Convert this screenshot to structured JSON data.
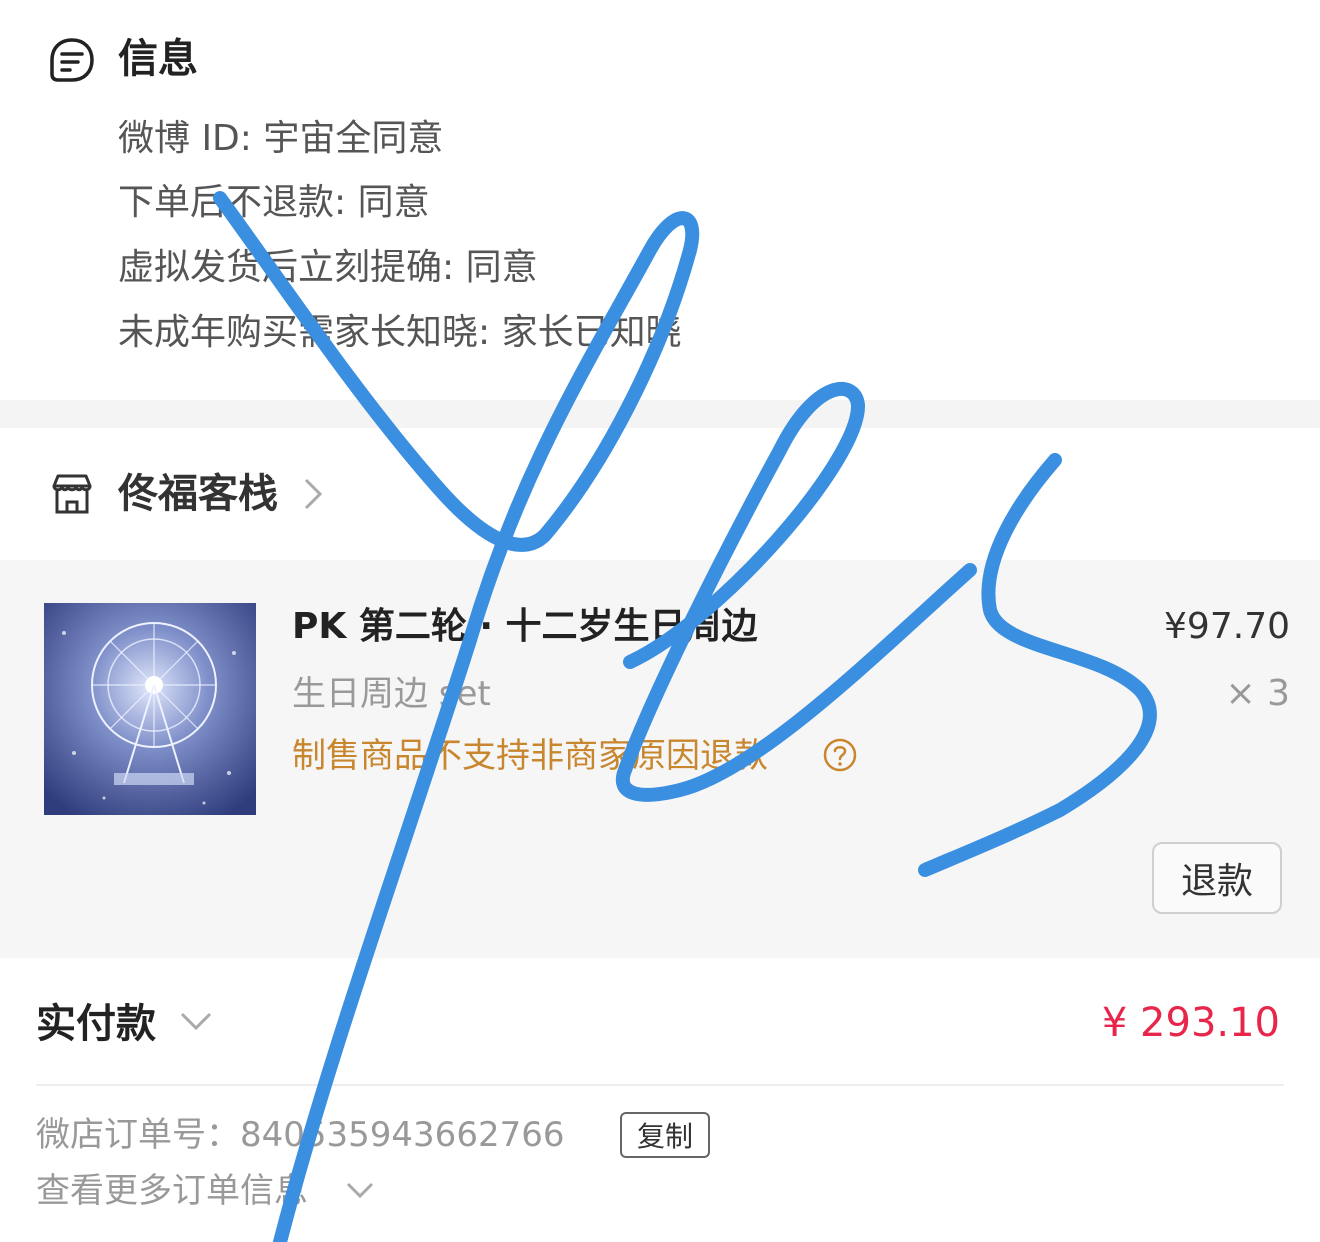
{
  "info": {
    "title": "信息",
    "icon": "message-list-icon",
    "lines": [
      "微博 ID: 宇宙全同意",
      "下单后不退款: 同意",
      "虚拟发货后立刻提确: 同意",
      "未成年购买需家长知晓: 家长已知晓"
    ]
  },
  "shop": {
    "name": "佟福客栈",
    "icon": "storefront-icon"
  },
  "product": {
    "title": "PK 第二轮 · 十二岁生日周边",
    "spec": "生日周边 set",
    "notice": "制售商品不支持非商家原因退款",
    "price": "¥97.70",
    "quantity": "× 3",
    "refund_label": "退款"
  },
  "summary": {
    "paid_label": "实付款",
    "paid_amount": "¥ 293.10",
    "order_label": "微店订单号：",
    "order_number": "840535943662766",
    "copy_label": "复制",
    "more_label": "查看更多订单信息"
  },
  "colors": {
    "accent_price": "#e8264b",
    "notice": "#c8862e",
    "scribble": "#3a8fe0"
  }
}
